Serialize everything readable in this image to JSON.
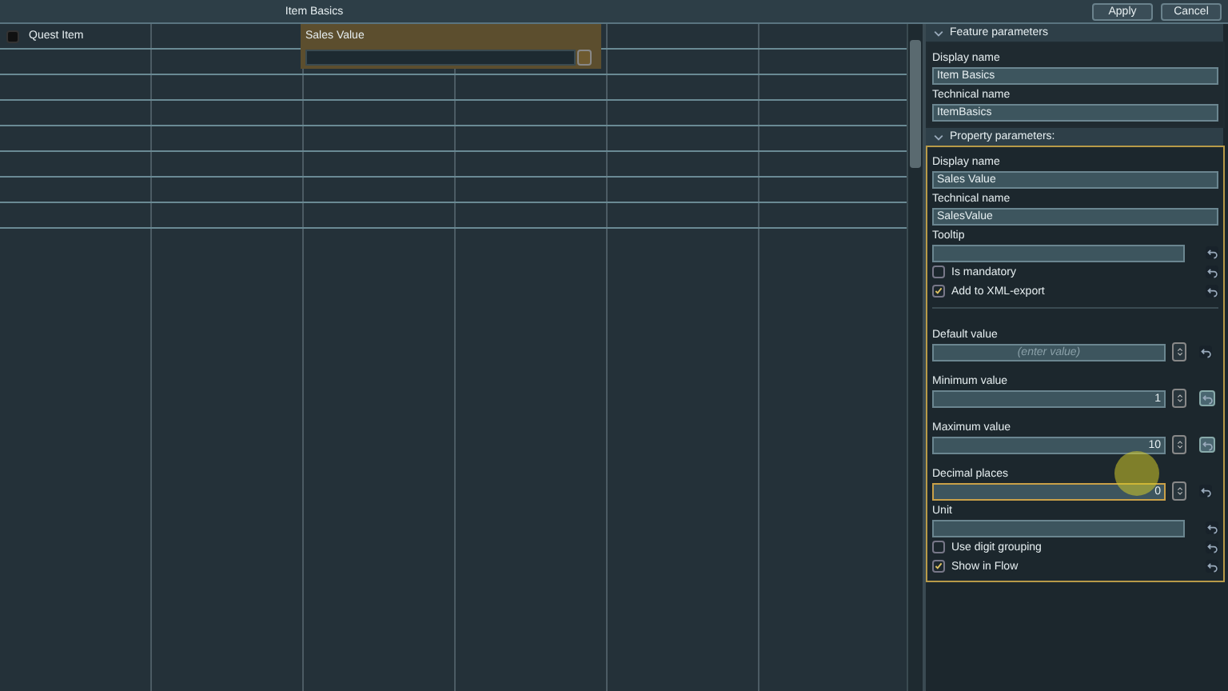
{
  "window": {
    "title": "Item Basics"
  },
  "buttons": [
    {
      "label": "Apply"
    },
    {
      "label": "Cancel"
    }
  ],
  "canvas": {
    "items": [
      {
        "kind": "checkbox",
        "label": "Quest Item",
        "checked": false
      },
      {
        "kind": "property",
        "label": "Sales Value",
        "selected": true
      }
    ]
  },
  "sections": [
    {
      "title": "Feature parameters",
      "expanded": true,
      "highlighted": false,
      "fields": [
        {
          "kind": "text",
          "label": "Display name",
          "value": "Item Basics"
        },
        {
          "kind": "text",
          "label": "Technical name",
          "value": "ItemBasics"
        }
      ]
    },
    {
      "title": "Property parameters:",
      "expanded": true,
      "highlighted": true,
      "fields": [
        {
          "kind": "text",
          "label": "Display name",
          "value": "Sales Value"
        },
        {
          "kind": "text",
          "label": "Technical name",
          "value": "SalesValue"
        },
        {
          "kind": "text-reset",
          "label": "Tooltip"
        },
        {
          "kind": "checkbox",
          "label": "Is mandatory",
          "checked": false
        },
        {
          "kind": "checkbox",
          "label": "Add to XML-export",
          "checked": true
        },
        {
          "kind": "divider"
        },
        {
          "kind": "number",
          "label": "Default value",
          "placeholder": "(enter value)",
          "reset_enabled": false,
          "focused": false
        },
        {
          "kind": "number",
          "label": "Minimum value",
          "value": "1",
          "reset_enabled": true,
          "focused": false
        },
        {
          "kind": "number",
          "label": "Maximum value",
          "value": "10",
          "reset_enabled": true,
          "focused": false
        },
        {
          "kind": "number",
          "label": "Decimal places",
          "value": "0",
          "reset_enabled": false,
          "focused": true
        },
        {
          "kind": "text-reset",
          "label": "Unit"
        },
        {
          "kind": "checkbox",
          "label": "Use digit grouping",
          "checked": false
        },
        {
          "kind": "checkbox",
          "label": "Show in Flow",
          "checked": true
        }
      ]
    }
  ]
}
